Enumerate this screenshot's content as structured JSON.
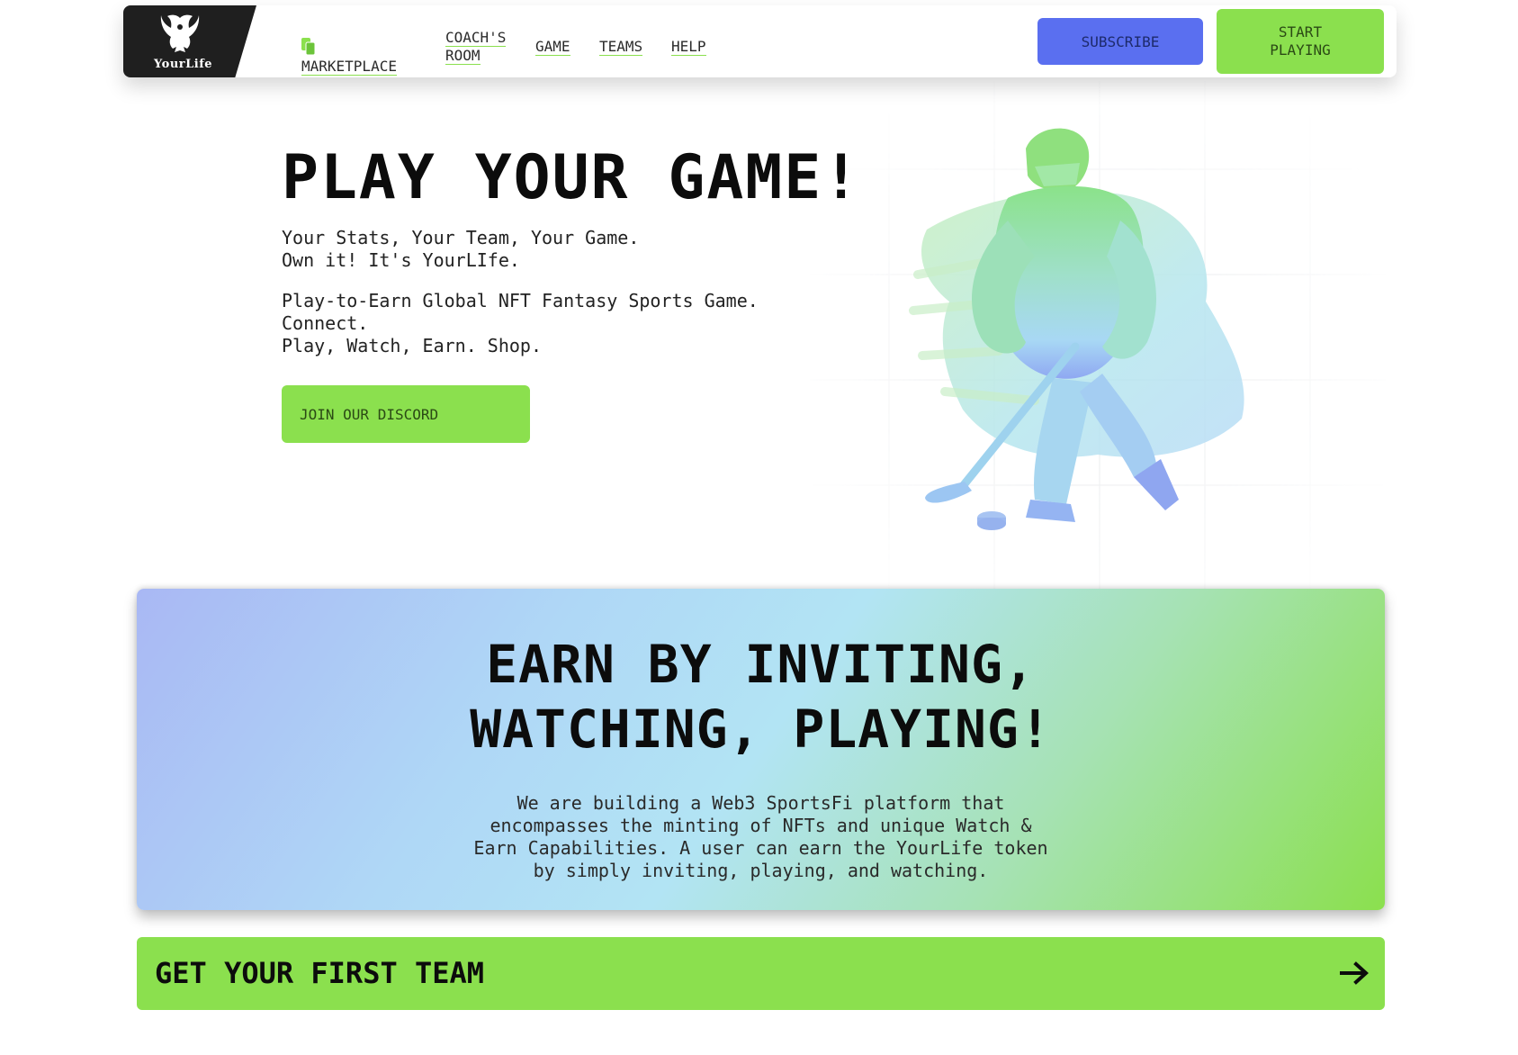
{
  "logo": {
    "text": "YourLife"
  },
  "nav": {
    "items": [
      {
        "label": "MARKETPLACE",
        "icon": "cards-icon"
      },
      {
        "label": "COACH'S ROOM"
      },
      {
        "label": "GAME"
      },
      {
        "label": "TEAMS"
      },
      {
        "label": "HELP"
      }
    ],
    "subscribe_label": "SUBSCRIBE",
    "start_label": "START PLAYING"
  },
  "hero": {
    "title": "PLAY YOUR GAME!",
    "subtitle_lines": [
      "Your Stats, Your Team, Your Game.",
      "Own it! It's YourLIfe."
    ],
    "description_lines": [
      "Play-to-Earn Global NFT Fantasy Sports Game.",
      "Connect.",
      "Play, Watch, Earn. Shop."
    ],
    "discord_label": "JOIN OUR DISCORD",
    "illustration": "hockey-player"
  },
  "earn": {
    "title_lines": [
      "EARN BY INVITING,",
      "WATCHING, PLAYING!"
    ],
    "text": "We are building a Web3 SportsFi platform that encompasses the minting of NFTs and unique Watch & Earn Capabilities. A user can earn the YourLife token by simply inviting, playing, and watching."
  },
  "cta": {
    "label": "GET YOUR FIRST TEAM",
    "icon": "arrow-right-icon"
  },
  "colors": {
    "accent_green": "#8be04e",
    "subscribe_blue": "#5a6ff0",
    "logo_bg": "#1f1f1f",
    "gradient_start": "#a9b8f4",
    "gradient_mid": "#b2e4f4",
    "gradient_end": "#8be04e"
  }
}
